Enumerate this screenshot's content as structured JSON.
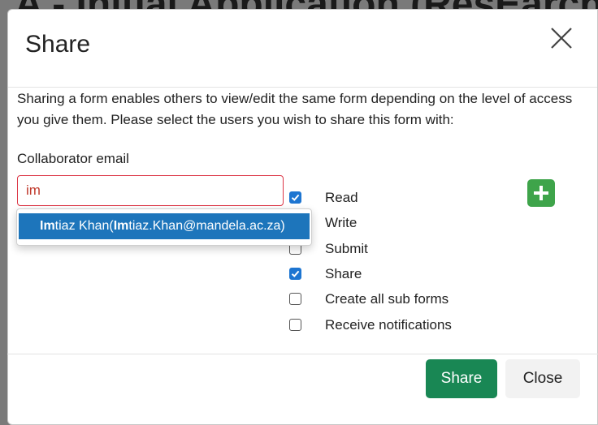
{
  "background": {
    "page_heading": "A - Initial Application (ResEarch"
  },
  "modal": {
    "title": "Share",
    "intro": "Sharing a form enables others to view/edit the same form depending on the level of access you give them. Please select the users you wish to share this form with:",
    "collaborator_label": "Collaborator email",
    "email_value": "im",
    "suggestion": {
      "match": "Im",
      "name_rest": "tiaz Khan(",
      "email_match": "Im",
      "email_rest": "tiaz.Khan@mandela.ac.za)"
    },
    "permissions": [
      {
        "label": "Read",
        "checked": true
      },
      {
        "label": "Write",
        "checked": false
      },
      {
        "label": "Submit",
        "checked": false
      },
      {
        "label": "Share",
        "checked": true
      },
      {
        "label": "Create all sub forms",
        "checked": false
      },
      {
        "label": "Receive notifications",
        "checked": false
      }
    ],
    "add_icon": "plus-icon",
    "share_button": "Share",
    "close_button": "Close"
  },
  "colors": {
    "primary_blue": "#1d75bb",
    "success_green": "#198754",
    "add_green": "#3ea44a",
    "error_red": "#dc3545"
  }
}
